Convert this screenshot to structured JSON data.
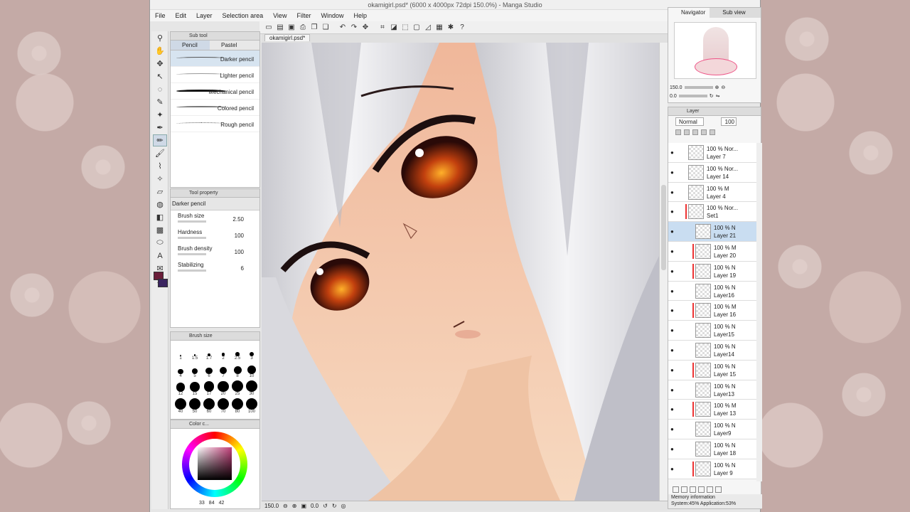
{
  "window": {
    "title": "okamigirl.psd* (6000 x 4000px 72dpi 150.0%) - Manga Studio"
  },
  "menu": [
    "File",
    "Edit",
    "Layer",
    "Selection area",
    "View",
    "Filter",
    "Window",
    "Help"
  ],
  "subtool": {
    "title": "Sub tool",
    "tabs": [
      "Pencil",
      "Pastel"
    ],
    "brushes": [
      "Darker pencil",
      "Lighter pencil",
      "Mechanical pencil",
      "Colored pencil",
      "Rough pencil"
    ]
  },
  "toolprop": {
    "title": "Tool property",
    "selected": "Darker pencil",
    "rows": [
      {
        "label": "Brush size",
        "value": "2.50"
      },
      {
        "label": "Hardness",
        "value": "100"
      },
      {
        "label": "Brush density",
        "value": "100"
      },
      {
        "label": "Stabilizing",
        "value": "6"
      }
    ]
  },
  "brushsize": {
    "title": "Brush size",
    "sizes": [
      "1",
      "1.5",
      "1.7",
      "2",
      "2.5",
      "3",
      "4",
      "5",
      "6",
      "7",
      "8",
      "10",
      "12",
      "15",
      "17",
      "20",
      "25",
      "30",
      "40",
      "50",
      "60",
      "70",
      "80",
      "100"
    ]
  },
  "color": {
    "title": "Color c...",
    "h": "330",
    "s": "33",
    "v": "84",
    "l": "42",
    "primary": "#6b1e3a",
    "secondary": "#3b2560"
  },
  "document": {
    "tab": "okamigirl.psd*"
  },
  "status": {
    "zoom": "150.0",
    "angle": "0.0"
  },
  "navigator": {
    "tabs": [
      "Navigator",
      "Sub view"
    ],
    "zoom": "150.0",
    "angle": "0.0"
  },
  "layers": {
    "title": "Layer",
    "blend": "Normal",
    "opacity": "100",
    "items": [
      {
        "opacity": "100 %",
        "mode": "Nor...",
        "name": "Layer 7",
        "indent": 0,
        "red": false
      },
      {
        "opacity": "100 %",
        "mode": "Nor...",
        "name": "Layer 14",
        "indent": 0,
        "red": false
      },
      {
        "opacity": "100 %",
        "mode": "M",
        "name": "Layer 4",
        "indent": 0,
        "red": false
      },
      {
        "opacity": "100 %",
        "mode": "Nor...",
        "name": "Set1",
        "indent": 0,
        "red": true
      },
      {
        "opacity": "100 %",
        "mode": "N",
        "name": "Layer 21",
        "indent": 1,
        "red": false,
        "selected": true
      },
      {
        "opacity": "100 %",
        "mode": "M",
        "name": "Layer 20",
        "indent": 1,
        "red": true
      },
      {
        "opacity": "100 %",
        "mode": "N",
        "name": "Layer 19",
        "indent": 1,
        "red": true
      },
      {
        "opacity": "100 %",
        "mode": "N",
        "name": "Layer16",
        "indent": 1,
        "red": false
      },
      {
        "opacity": "100 %",
        "mode": "M",
        "name": "Layer 16",
        "indent": 1,
        "red": true
      },
      {
        "opacity": "100 %",
        "mode": "N",
        "name": "Layer15",
        "indent": 1,
        "red": false
      },
      {
        "opacity": "100 %",
        "mode": "N",
        "name": "Layer14",
        "indent": 1,
        "red": false
      },
      {
        "opacity": "100 %",
        "mode": "N",
        "name": "Layer 15",
        "indent": 1,
        "red": true
      },
      {
        "opacity": "100 %",
        "mode": "N",
        "name": "Layer13",
        "indent": 1,
        "red": false
      },
      {
        "opacity": "100 %",
        "mode": "M",
        "name": "Layer 13",
        "indent": 1,
        "red": true
      },
      {
        "opacity": "100 %",
        "mode": "N",
        "name": "Layer9",
        "indent": 1,
        "red": false
      },
      {
        "opacity": "100 %",
        "mode": "N",
        "name": "Layer 18",
        "indent": 1,
        "red": false
      },
      {
        "opacity": "100 %",
        "mode": "N",
        "name": "Layer 9",
        "indent": 1,
        "red": true
      }
    ]
  },
  "memory": {
    "title": "Memory information",
    "system": "System:45%",
    "application": "Application:53%"
  }
}
